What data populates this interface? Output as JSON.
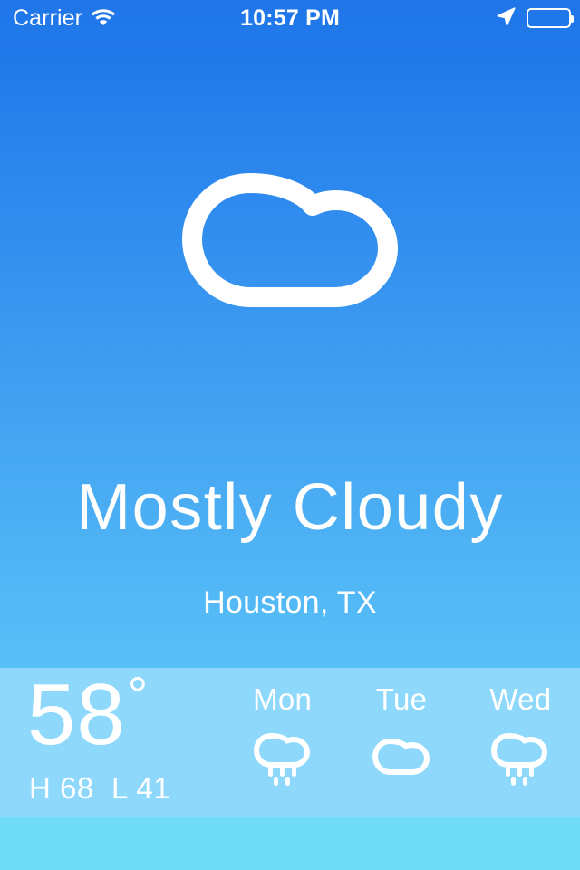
{
  "status_bar": {
    "carrier": "Carrier",
    "wifi_icon": "wifi-icon",
    "time": "10:57 PM",
    "location_arrow_icon": "location-arrow-icon",
    "battery_icon": "battery-icon",
    "battery_level_percent": 0
  },
  "hero": {
    "icon": "cloud-icon",
    "condition": "Mostly Cloudy",
    "location": "Houston, TX"
  },
  "current": {
    "temperature": "58",
    "degree_symbol": "°",
    "high_low": "H 68  L 41"
  },
  "forecast": [
    {
      "day": "Mon",
      "icon": "rain-cloud-icon"
    },
    {
      "day": "Tue",
      "icon": "cloud-icon"
    },
    {
      "day": "Wed",
      "icon": "rain-cloud-icon"
    }
  ],
  "colors": {
    "gradient_top": "#1f76e9",
    "gradient_bottom": "#58c0f8",
    "panel": "#8ed8fb",
    "bottom_strip": "#6edcf7",
    "text": "#ffffff"
  }
}
